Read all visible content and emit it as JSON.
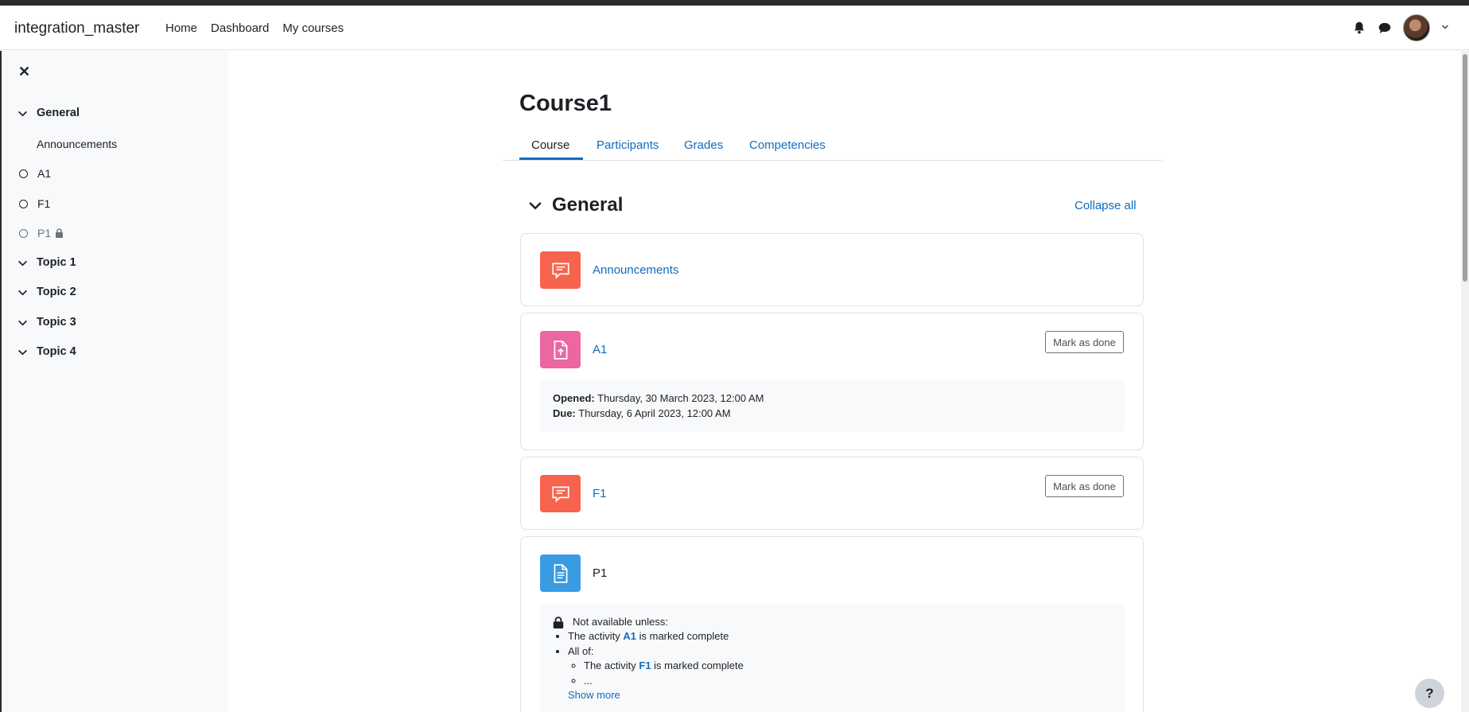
{
  "site": {
    "name": "integration_master"
  },
  "nav": {
    "links": [
      "Home",
      "Dashboard",
      "My courses"
    ]
  },
  "drawer": {
    "close_label": "✕",
    "items": [
      {
        "label": "General",
        "kind": "section"
      },
      {
        "label": "Announcements",
        "kind": "activity-indent"
      },
      {
        "label": "A1",
        "kind": "activity"
      },
      {
        "label": "F1",
        "kind": "activity"
      },
      {
        "label": "P1",
        "kind": "activity-locked"
      },
      {
        "label": "Topic 1",
        "kind": "section"
      },
      {
        "label": "Topic 2",
        "kind": "section"
      },
      {
        "label": "Topic 3",
        "kind": "section"
      },
      {
        "label": "Topic 4",
        "kind": "section"
      }
    ]
  },
  "course": {
    "title": "Course1",
    "tabs": [
      "Course",
      "Participants",
      "Grades",
      "Competencies"
    ],
    "active_tab": "Course"
  },
  "section": {
    "title": "General",
    "collapse_all": "Collapse all"
  },
  "activities": {
    "announcements": {
      "name": "Announcements",
      "icon": "forum-icon",
      "color": "#f7634d"
    },
    "a1": {
      "name": "A1",
      "icon": "assignment-icon",
      "color": "#eb66a2",
      "button": "Mark as done",
      "opened_label": "Opened:",
      "opened_value": "Thursday, 30 March 2023, 12:00 AM",
      "due_label": "Due:",
      "due_value": "Thursday, 6 April 2023, 12:00 AM"
    },
    "f1": {
      "name": "F1",
      "icon": "forum-icon",
      "color": "#f7634d",
      "button": "Mark as done"
    },
    "p1": {
      "name": "P1",
      "icon": "page-icon",
      "color": "#399be2",
      "restriction": {
        "heading": "Not available unless:",
        "line1_pre": "The activity",
        "line1_link": "A1",
        "line1_post": "is marked complete",
        "line2": "All of:",
        "sub1_pre": "The activity",
        "sub1_link": "F1",
        "sub1_post": "is marked complete",
        "sub2": "...",
        "show_more": "Show more"
      }
    }
  },
  "help": {
    "label": "?"
  }
}
